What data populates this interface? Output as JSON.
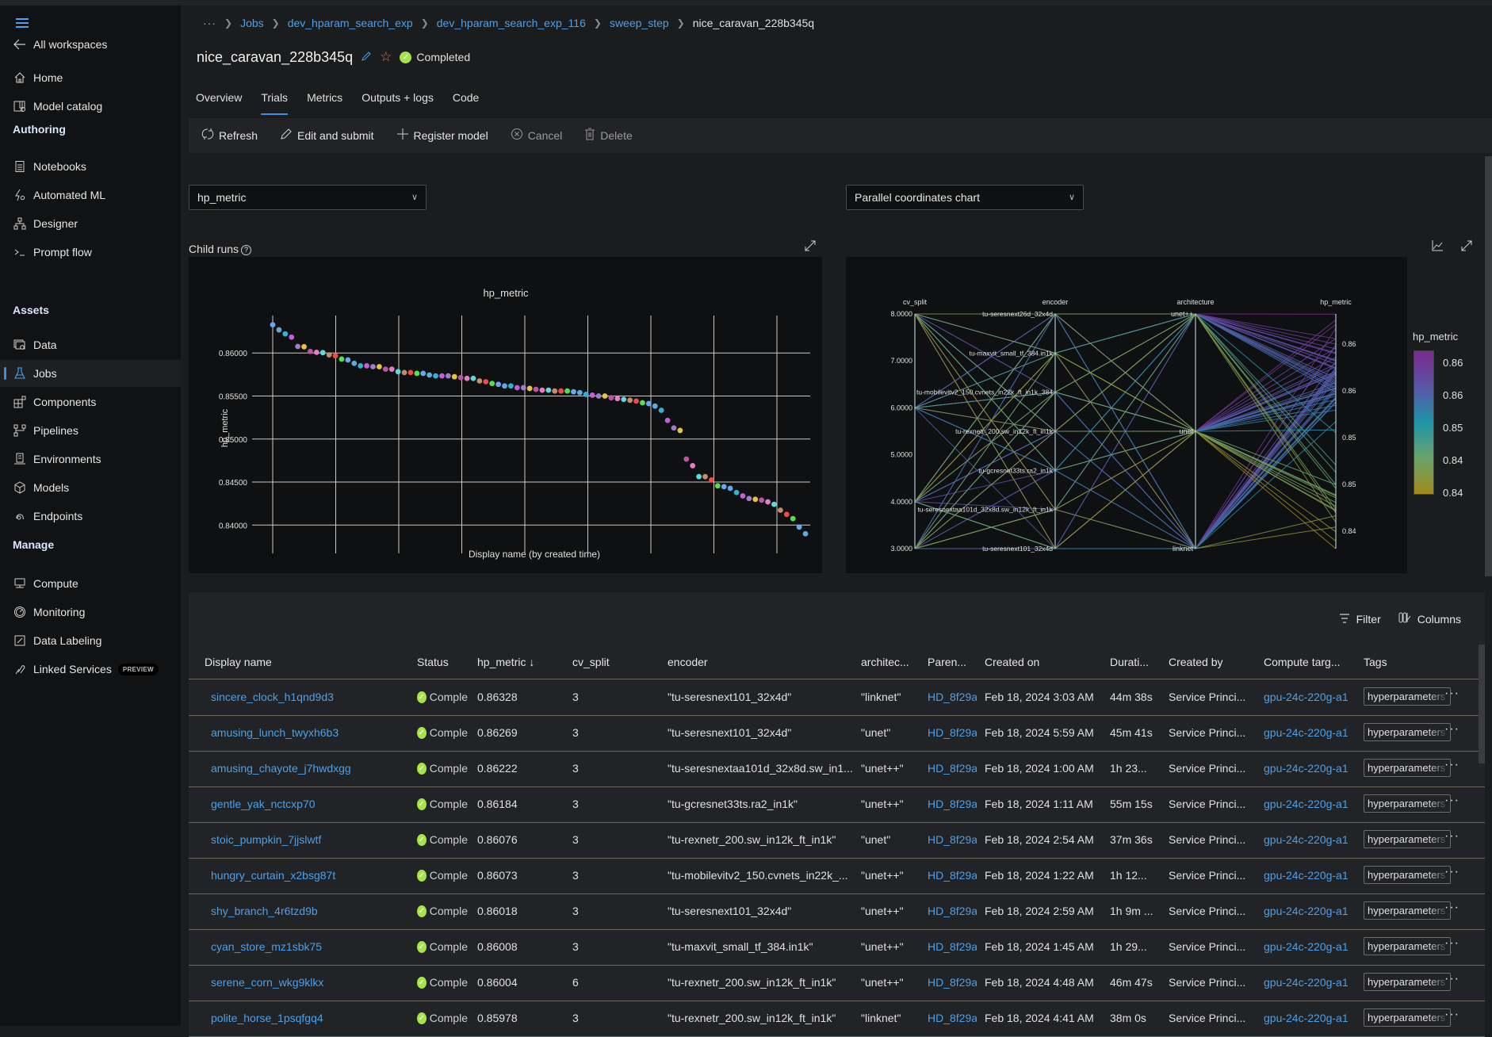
{
  "sidebar": {
    "back_label": "All workspaces",
    "top_items": [
      {
        "label": "Home",
        "icon": "home-icon"
      },
      {
        "label": "Model catalog",
        "icon": "model-catalog-icon"
      }
    ],
    "sections": [
      {
        "title": "Authoring",
        "items": [
          {
            "label": "Notebooks",
            "icon": "notebook-icon"
          },
          {
            "label": "Automated ML",
            "icon": "automated-ml-icon"
          },
          {
            "label": "Designer",
            "icon": "designer-icon"
          },
          {
            "label": "Prompt flow",
            "icon": "prompt-flow-icon"
          }
        ]
      },
      {
        "title": "Assets",
        "items": [
          {
            "label": "Data",
            "icon": "data-icon"
          },
          {
            "label": "Jobs",
            "icon": "flask-icon",
            "active": true
          },
          {
            "label": "Components",
            "icon": "components-icon"
          },
          {
            "label": "Pipelines",
            "icon": "pipelines-icon"
          },
          {
            "label": "Environments",
            "icon": "environments-icon"
          },
          {
            "label": "Models",
            "icon": "cube-icon"
          },
          {
            "label": "Endpoints",
            "icon": "endpoints-icon"
          }
        ]
      },
      {
        "title": "Manage",
        "items": [
          {
            "label": "Compute",
            "icon": "compute-icon"
          },
          {
            "label": "Monitoring",
            "icon": "monitoring-icon"
          },
          {
            "label": "Data Labeling",
            "icon": "data-labeling-icon"
          },
          {
            "label": "Linked Services",
            "icon": "linked-services-icon",
            "badge": "PREVIEW"
          }
        ]
      }
    ]
  },
  "breadcrumb": {
    "overflow": "···",
    "items": [
      "Jobs",
      "dev_hparam_search_exp",
      "dev_hparam_search_exp_116",
      "sweep_step"
    ],
    "current": "nice_caravan_228b345q"
  },
  "header": {
    "title": "nice_caravan_228b345q",
    "status": "Completed"
  },
  "tabs": [
    {
      "label": "Overview"
    },
    {
      "label": "Trials",
      "active": true
    },
    {
      "label": "Metrics"
    },
    {
      "label": "Outputs + logs"
    },
    {
      "label": "Code"
    }
  ],
  "toolbar": {
    "refresh": "Refresh",
    "edit_submit": "Edit and submit",
    "register_model": "Register model",
    "cancel": "Cancel",
    "delete": "Delete"
  },
  "controls": {
    "metric_select": "hp_metric",
    "chart_type_select": "Parallel coordinates chart",
    "child_runs_label": "Child runs",
    "help_glyph": "?"
  },
  "chart_data": [
    {
      "type": "scatter",
      "title": "hp_metric",
      "xlabel": "Display name (by created time)",
      "ylabel": "hp_metric",
      "ylim": [
        0.838,
        0.8638
      ],
      "yticks": [
        "0.86000",
        "0.85500",
        "0.85000",
        "0.84500",
        "0.84000"
      ],
      "ytick_values": [
        0.86,
        0.855,
        0.85,
        0.845,
        0.84
      ],
      "grid": true,
      "series_colors": [
        "#6aa7f0",
        "#5fa9e0",
        "#2db4d0",
        "#c55ed8",
        "#9a7fcc",
        "#e7c43c",
        "#b8579d",
        "#e77dc6",
        "#5ed8d8",
        "#c18e6a",
        "#f04a4a",
        "#55e04a"
      ],
      "values": [
        0.86328,
        0.86269,
        0.86222,
        0.86184,
        0.86076,
        0.86073,
        0.86018,
        0.86008,
        0.86004,
        0.85978,
        0.85968,
        0.85929,
        0.85919,
        0.8588,
        0.85851,
        0.85851,
        0.85841,
        0.85841,
        0.85812,
        0.85812,
        0.85783,
        0.85773,
        0.85773,
        0.85763,
        0.85763,
        0.85744,
        0.85734,
        0.85734,
        0.85734,
        0.85724,
        0.85714,
        0.85705,
        0.85705,
        0.85675,
        0.85666,
        0.85646,
        0.85636,
        0.85617,
        0.85617,
        0.85597,
        0.85597,
        0.85588,
        0.85578,
        0.85568,
        0.85568,
        0.85558,
        0.85558,
        0.85558,
        0.85549,
        0.85539,
        0.85519,
        0.8551,
        0.855,
        0.855,
        0.8548,
        0.8547,
        0.85461,
        0.85451,
        0.85441,
        0.85422,
        0.85412,
        0.85383,
        0.85334,
        0.85217,
        0.85129,
        0.851,
        0.84767,
        0.8469,
        0.84563,
        0.84563,
        0.84524,
        0.84456,
        0.84446,
        0.84427,
        0.84378,
        0.84339,
        0.84309,
        0.843,
        0.8429,
        0.8427,
        0.84241,
        0.84173,
        0.84124,
        0.84075,
        0.83977,
        0.83899
      ]
    },
    {
      "type": "parallel_coordinates",
      "axes": [
        {
          "name": "cv_split",
          "ticks": [
            "8.0000",
            "7.0000",
            "6.0000",
            "5.0000",
            "4.0000",
            "3.0000"
          ],
          "range": [
            3,
            8
          ]
        },
        {
          "name": "encoder",
          "ticks": [
            "tu-seresnext26d_32x4d",
            "tu-maxvit_small_tf_384.in1k",
            "tu-mobilevitv2_150.cvnets_in22k_ft_in1k_384",
            "tu-rexnetr_200.sw_in12k_ft_in1k",
            "tu-gcresnet33ts.ra2_in1k",
            "tu-seresnextaa101d_32x8d.sw_in12k_ft_in1k",
            "tu-seresnext101_32x4d"
          ]
        },
        {
          "name": "architecture",
          "ticks": [
            "unet++",
            "unet",
            "linknet"
          ]
        },
        {
          "name": "hp_metric",
          "ticks": [
            "0.86",
            "0.86",
            "0.85",
            "0.85",
            "0.84"
          ],
          "range": [
            0.839,
            0.8633
          ]
        }
      ],
      "colorbar": {
        "title": "hp_metric",
        "labels": [
          "0.86",
          "0.86",
          "0.85",
          "0.84",
          "0.84"
        ],
        "colors": [
          "#7b2a8f",
          "#5a55a8",
          "#1f95a8",
          "#6aa36a",
          "#a08a1a"
        ]
      }
    }
  ],
  "table": {
    "tools": {
      "filter": "Filter",
      "columns": "Columns"
    },
    "headers": [
      "Display name",
      "Status",
      "hp_metric ↓",
      "cv_split",
      "encoder",
      "architec...",
      "Paren...",
      "Created on",
      "Durati...",
      "Created by",
      "Compute targ...",
      "Tags"
    ],
    "rows": [
      {
        "name": "sincere_clock_h1qnd9d3",
        "status": "Comple",
        "hp_metric": "0.86328",
        "cv_split": "3",
        "encoder": "\"tu-seresnext101_32x4d\"",
        "architecture": "\"linknet\"",
        "parent": "HD_8f29a",
        "created_on": "Feb 18, 2024 3:03 AM",
        "duration": "44m 38s",
        "created_by": "Service Princi...",
        "compute": "gpu-24c-220g-a1",
        "tags": "hyperparameters"
      },
      {
        "name": "amusing_lunch_twyxh6b3",
        "status": "Comple",
        "hp_metric": "0.86269",
        "cv_split": "3",
        "encoder": "\"tu-seresnext101_32x4d\"",
        "architecture": "\"unet\"",
        "parent": "HD_8f29a",
        "created_on": "Feb 18, 2024 5:59 AM",
        "duration": "45m 41s",
        "created_by": "Service Princi...",
        "compute": "gpu-24c-220g-a1",
        "tags": "hyperparameters"
      },
      {
        "name": "amusing_chayote_j7hwdxgg",
        "status": "Comple",
        "hp_metric": "0.86222",
        "cv_split": "3",
        "encoder": "\"tu-seresnextaa101d_32x8d.sw_in1...",
        "architecture": "\"unet++\"",
        "parent": "HD_8f29a",
        "created_on": "Feb 18, 2024 1:00 AM",
        "duration": "1h 23...",
        "created_by": "Service Princi...",
        "compute": "gpu-24c-220g-a1",
        "tags": "hyperparameters"
      },
      {
        "name": "gentle_yak_nctcxp70",
        "status": "Comple",
        "hp_metric": "0.86184",
        "cv_split": "3",
        "encoder": "\"tu-gcresnet33ts.ra2_in1k\"",
        "architecture": "\"unet++\"",
        "parent": "HD_8f29a",
        "created_on": "Feb 18, 2024 1:11 AM",
        "duration": "55m 15s",
        "created_by": "Service Princi...",
        "compute": "gpu-24c-220g-a1",
        "tags": "hyperparameters"
      },
      {
        "name": "stoic_pumpkin_7jjslwtf",
        "status": "Comple",
        "hp_metric": "0.86076",
        "cv_split": "3",
        "encoder": "\"tu-rexnetr_200.sw_in12k_ft_in1k\"",
        "architecture": "\"unet\"",
        "parent": "HD_8f29a",
        "created_on": "Feb 18, 2024 2:54 AM",
        "duration": "37m 36s",
        "created_by": "Service Princi...",
        "compute": "gpu-24c-220g-a1",
        "tags": "hyperparameters"
      },
      {
        "name": "hungry_curtain_x2bsg87t",
        "status": "Comple",
        "hp_metric": "0.86073",
        "cv_split": "3",
        "encoder": "\"tu-mobilevitv2_150.cvnets_in22k_...",
        "architecture": "\"unet++\"",
        "parent": "HD_8f29a",
        "created_on": "Feb 18, 2024 1:22 AM",
        "duration": "1h 12...",
        "created_by": "Service Princi...",
        "compute": "gpu-24c-220g-a1",
        "tags": "hyperparameters"
      },
      {
        "name": "shy_branch_4r6tzd9b",
        "status": "Comple",
        "hp_metric": "0.86018",
        "cv_split": "3",
        "encoder": "\"tu-seresnext101_32x4d\"",
        "architecture": "\"unet++\"",
        "parent": "HD_8f29a",
        "created_on": "Feb 18, 2024 2:59 AM",
        "duration": "1h 9m ...",
        "created_by": "Service Princi...",
        "compute": "gpu-24c-220g-a1",
        "tags": "hyperparameters"
      },
      {
        "name": "cyan_store_mz1sbk75",
        "status": "Comple",
        "hp_metric": "0.86008",
        "cv_split": "3",
        "encoder": "\"tu-maxvit_small_tf_384.in1k\"",
        "architecture": "\"unet++\"",
        "parent": "HD_8f29a",
        "created_on": "Feb 18, 2024 1:45 AM",
        "duration": "1h 29...",
        "created_by": "Service Princi...",
        "compute": "gpu-24c-220g-a1",
        "tags": "hyperparameters"
      },
      {
        "name": "serene_corn_wkg9klkx",
        "status": "Comple",
        "hp_metric": "0.86004",
        "cv_split": "6",
        "encoder": "\"tu-rexnetr_200.sw_in12k_ft_in1k\"",
        "architecture": "\"unet++\"",
        "parent": "HD_8f29a",
        "created_on": "Feb 18, 2024 4:48 AM",
        "duration": "46m 47s",
        "created_by": "Service Princi...",
        "compute": "gpu-24c-220g-a1",
        "tags": "hyperparameters"
      },
      {
        "name": "polite_horse_1psqfgq4",
        "status": "Comple",
        "hp_metric": "0.85978",
        "cv_split": "3",
        "encoder": "\"tu-rexnetr_200.sw_in12k_ft_in1k\"",
        "architecture": "\"linknet\"",
        "parent": "HD_8f29a",
        "created_on": "Feb 18, 2024 4:41 AM",
        "duration": "38m 0s",
        "created_by": "Service Princi...",
        "compute": "gpu-24c-220g-a1",
        "tags": "hyperparameters"
      }
    ],
    "more_glyph": "···"
  }
}
